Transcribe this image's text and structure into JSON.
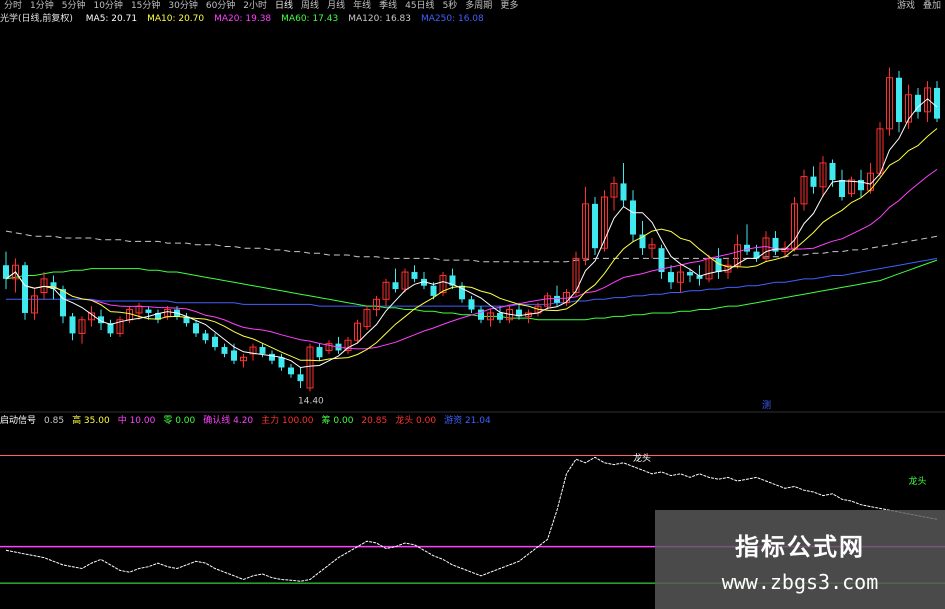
{
  "toolbar": {
    "periods": [
      {
        "label": "分时",
        "active": false
      },
      {
        "label": "1分钟",
        "active": false
      },
      {
        "label": "5分钟",
        "active": false
      },
      {
        "label": "10分钟",
        "active": false
      },
      {
        "label": "15分钟",
        "active": false
      },
      {
        "label": "30分钟",
        "active": false
      },
      {
        "label": "60分钟",
        "active": false
      },
      {
        "label": "2小时",
        "active": false
      },
      {
        "label": "日线",
        "active": true
      },
      {
        "label": "周线",
        "active": false
      },
      {
        "label": "月线",
        "active": false
      },
      {
        "label": "年线",
        "active": false
      },
      {
        "label": "季线",
        "active": false
      },
      {
        "label": "45日线",
        "active": false
      },
      {
        "label": "5秒",
        "active": false
      },
      {
        "label": "多周期",
        "active": false
      },
      {
        "label": "更多",
        "active": false
      }
    ],
    "right": [
      "游戏",
      "叠加"
    ]
  },
  "ma_legend": {
    "title": "光学(日线,前复权)",
    "items": [
      {
        "label": "MA5: 20.71",
        "color": "#ffffff"
      },
      {
        "label": "MA10: 20.70",
        "color": "#ffff40"
      },
      {
        "label": "MA20: 19.38",
        "color": "#ff40ff"
      },
      {
        "label": "MA60: 17.43",
        "color": "#40ff40"
      },
      {
        "label": "MA120: 16.83",
        "color": "#c8c8c8"
      },
      {
        "label": "MA250: 16.08",
        "color": "#4060ff"
      }
    ]
  },
  "annotations": {
    "low_price": "14.40",
    "bottom_marker": "测",
    "top_label": "龙头",
    "right_label": "龙头"
  },
  "indicator_legend": {
    "items": [
      {
        "label": "启动信号",
        "color": "#ffffff"
      },
      {
        "label": "0.85",
        "color": "#c8c8c8"
      },
      {
        "label": "高 35.00",
        "color": "#ffff40"
      },
      {
        "label": "中 10.00",
        "color": "#ff40ff"
      },
      {
        "label": "零 0.00",
        "color": "#40ff40"
      },
      {
        "label": "确认线 4.20",
        "color": "#ff40ff"
      },
      {
        "label": "主力 100.00",
        "color": "#ff3030"
      },
      {
        "label": "筹 0.00",
        "color": "#40ff40"
      },
      {
        "label": "20.85",
        "color": "#ff3030"
      },
      {
        "label": "龙头 0.00",
        "color": "#ff3030"
      },
      {
        "label": "游资 21.04",
        "color": "#4060ff"
      }
    ]
  },
  "colors": {
    "up": "#ff3030",
    "down": "#40e8f0",
    "ma5": "#ffffff",
    "ma10": "#ffff40",
    "ma20": "#ff40ff",
    "ma60": "#40ff40",
    "ma120": "#c8c8c8",
    "ma250": "#4060ff"
  },
  "chart_data": {
    "type": "candlestick",
    "title": "",
    "xlabel": "",
    "ylabel": "",
    "ylim": [
      13.5,
      24.5
    ],
    "candles": [
      [
        17.6,
        18.0,
        16.9,
        17.2
      ],
      [
        17.2,
        17.8,
        16.8,
        17.6
      ],
      [
        17.6,
        17.7,
        16.0,
        16.2
      ],
      [
        16.2,
        16.9,
        16.0,
        16.7
      ],
      [
        16.8,
        17.4,
        16.6,
        17.2
      ],
      [
        17.1,
        17.3,
        16.6,
        16.9
      ],
      [
        16.9,
        17.0,
        15.9,
        16.1
      ],
      [
        16.1,
        16.2,
        15.4,
        15.6
      ],
      [
        15.6,
        16.1,
        15.3,
        16.0
      ],
      [
        16.0,
        16.4,
        15.8,
        16.2
      ],
      [
        16.1,
        16.3,
        15.7,
        15.9
      ],
      [
        15.9,
        16.0,
        15.5,
        15.6
      ],
      [
        15.6,
        16.1,
        15.5,
        16.0
      ],
      [
        16.0,
        16.4,
        15.9,
        16.3
      ],
      [
        16.2,
        16.5,
        16.0,
        16.4
      ],
      [
        16.3,
        16.4,
        16.0,
        16.2
      ],
      [
        16.2,
        16.3,
        15.9,
        16.0
      ],
      [
        16.1,
        16.4,
        16.0,
        16.3
      ],
      [
        16.3,
        16.4,
        16.0,
        16.1
      ],
      [
        16.1,
        16.2,
        15.8,
        15.9
      ],
      [
        15.9,
        16.0,
        15.5,
        15.6
      ],
      [
        15.6,
        15.7,
        15.3,
        15.4
      ],
      [
        15.5,
        15.6,
        15.1,
        15.2
      ],
      [
        15.2,
        15.3,
        14.9,
        15.0
      ],
      [
        15.1,
        15.3,
        14.7,
        14.8
      ],
      [
        14.8,
        15.0,
        14.6,
        14.9
      ],
      [
        15.0,
        15.3,
        14.8,
        15.2
      ],
      [
        15.2,
        15.3,
        14.9,
        15.0
      ],
      [
        15.0,
        15.1,
        14.7,
        14.8
      ],
      [
        14.9,
        15.0,
        14.5,
        14.6
      ],
      [
        14.6,
        14.7,
        14.3,
        14.4
      ],
      [
        14.4,
        14.6,
        14.0,
        14.2
      ],
      [
        14.0,
        15.3,
        13.9,
        15.2
      ],
      [
        15.2,
        15.3,
        14.8,
        14.9
      ],
      [
        15.1,
        15.4,
        15.0,
        15.3
      ],
      [
        15.3,
        15.5,
        15.0,
        15.1
      ],
      [
        15.1,
        15.5,
        15.0,
        15.4
      ],
      [
        15.4,
        16.0,
        15.3,
        15.9
      ],
      [
        15.8,
        16.4,
        15.7,
        16.3
      ],
      [
        16.3,
        16.7,
        16.1,
        16.6
      ],
      [
        16.6,
        17.2,
        16.4,
        17.1
      ],
      [
        17.1,
        17.5,
        16.8,
        16.9
      ],
      [
        16.9,
        17.5,
        16.8,
        17.4
      ],
      [
        17.4,
        17.6,
        17.1,
        17.2
      ],
      [
        17.2,
        17.4,
        16.9,
        17.0
      ],
      [
        17.0,
        17.1,
        16.6,
        16.7
      ],
      [
        16.8,
        17.4,
        16.7,
        17.3
      ],
      [
        17.3,
        17.5,
        16.9,
        17.0
      ],
      [
        17.0,
        17.1,
        16.5,
        16.6
      ],
      [
        16.6,
        16.7,
        16.2,
        16.3
      ],
      [
        16.3,
        16.4,
        15.9,
        16.0
      ],
      [
        16.0,
        16.3,
        15.8,
        16.2
      ],
      [
        16.2,
        16.4,
        15.9,
        16.0
      ],
      [
        16.0,
        16.4,
        15.9,
        16.3
      ],
      [
        16.3,
        16.5,
        16.0,
        16.1
      ],
      [
        16.1,
        16.3,
        15.9,
        16.2
      ],
      [
        16.2,
        16.5,
        16.1,
        16.4
      ],
      [
        16.4,
        16.8,
        16.3,
        16.7
      ],
      [
        16.7,
        17.0,
        16.4,
        16.5
      ],
      [
        16.5,
        16.9,
        16.4,
        16.8
      ],
      [
        16.8,
        18.0,
        16.7,
        17.8
      ],
      [
        17.8,
        19.9,
        17.6,
        19.4
      ],
      [
        19.4,
        19.6,
        17.9,
        18.1
      ],
      [
        18.1,
        19.8,
        18.0,
        19.6
      ],
      [
        19.6,
        20.2,
        19.2,
        20.0
      ],
      [
        20.0,
        20.6,
        19.3,
        19.5
      ],
      [
        19.5,
        19.8,
        18.3,
        18.5
      ],
      [
        18.5,
        18.9,
        17.9,
        18.1
      ],
      [
        18.1,
        18.4,
        17.8,
        18.2
      ],
      [
        18.1,
        18.2,
        17.2,
        17.4
      ],
      [
        17.4,
        17.6,
        16.9,
        17.1
      ],
      [
        17.1,
        17.6,
        16.8,
        17.4
      ],
      [
        17.4,
        17.5,
        17.1,
        17.3
      ],
      [
        17.3,
        17.6,
        17.0,
        17.2
      ],
      [
        17.2,
        17.9,
        17.1,
        17.8
      ],
      [
        17.8,
        18.1,
        17.2,
        17.4
      ],
      [
        17.4,
        17.8,
        17.2,
        17.6
      ],
      [
        17.6,
        18.5,
        17.5,
        18.2
      ],
      [
        18.2,
        18.8,
        17.9,
        18.0
      ],
      [
        18.0,
        18.2,
        17.7,
        17.8
      ],
      [
        17.8,
        18.6,
        17.7,
        18.4
      ],
      [
        18.4,
        18.6,
        17.9,
        18.0
      ],
      [
        18.0,
        18.3,
        17.8,
        18.1
      ],
      [
        18.1,
        19.6,
        18.0,
        19.4
      ],
      [
        19.4,
        20.4,
        19.2,
        20.2
      ],
      [
        20.2,
        20.5,
        19.7,
        19.9
      ],
      [
        19.9,
        20.8,
        19.6,
        20.6
      ],
      [
        20.6,
        20.7,
        19.9,
        20.1
      ],
      [
        20.1,
        20.4,
        19.5,
        19.6
      ],
      [
        19.7,
        20.2,
        19.6,
        20.1
      ],
      [
        20.1,
        20.4,
        19.6,
        19.8
      ],
      [
        19.8,
        20.6,
        19.7,
        20.3
      ],
      [
        20.3,
        21.8,
        20.2,
        21.6
      ],
      [
        21.6,
        23.4,
        21.4,
        23.1
      ],
      [
        23.1,
        23.3,
        21.5,
        21.8
      ],
      [
        21.8,
        22.9,
        21.6,
        22.6
      ],
      [
        22.6,
        22.8,
        21.9,
        22.1
      ],
      [
        22.1,
        23.0,
        21.8,
        22.8
      ],
      [
        22.8,
        23.0,
        21.8,
        21.9
      ]
    ],
    "ma120": [
      18.6,
      18.55,
      18.5,
      18.45,
      18.45,
      18.45,
      18.4,
      18.4,
      18.4,
      18.4,
      18.35,
      18.35,
      18.35,
      18.3,
      18.3,
      18.3,
      18.3,
      18.25,
      18.25,
      18.25,
      18.2,
      18.2,
      18.2,
      18.15,
      18.15,
      18.1,
      18.1,
      18.1,
      18.05,
      18.05,
      18.0,
      18.0,
      17.95,
      17.95,
      17.9,
      17.9,
      17.9,
      17.85,
      17.85,
      17.85,
      17.8,
      17.8,
      17.8,
      17.8,
      17.8,
      17.8,
      17.75,
      17.75,
      17.75,
      17.75,
      17.7,
      17.7,
      17.7,
      17.7,
      17.7,
      17.7,
      17.7,
      17.7,
      17.7,
      17.7,
      17.75,
      17.75,
      17.8,
      17.8,
      17.8,
      17.8,
      17.8,
      17.8,
      17.8,
      17.8,
      17.8,
      17.8,
      17.8,
      17.8,
      17.8,
      17.8,
      17.8,
      17.8,
      17.8,
      17.8,
      17.85,
      17.85,
      17.85,
      17.9,
      17.9,
      17.95,
      17.95,
      18.0,
      18.0,
      18.05,
      18.05,
      18.1,
      18.15,
      18.2,
      18.25,
      18.3,
      18.35,
      18.4,
      18.45
    ],
    "ma250": [
      16.6,
      16.6,
      16.6,
      16.6,
      16.6,
      16.6,
      16.6,
      16.6,
      16.6,
      16.6,
      16.55,
      16.55,
      16.55,
      16.55,
      16.55,
      16.55,
      16.55,
      16.55,
      16.5,
      16.5,
      16.5,
      16.5,
      16.5,
      16.5,
      16.5,
      16.45,
      16.45,
      16.45,
      16.45,
      16.45,
      16.45,
      16.45,
      16.45,
      16.4,
      16.4,
      16.4,
      16.4,
      16.4,
      16.4,
      16.4,
      16.4,
      16.4,
      16.4,
      16.4,
      16.4,
      16.4,
      16.4,
      16.4,
      16.4,
      16.4,
      16.4,
      16.4,
      16.4,
      16.4,
      16.45,
      16.45,
      16.45,
      16.45,
      16.5,
      16.5,
      16.55,
      16.55,
      16.6,
      16.6,
      16.65,
      16.65,
      16.7,
      16.7,
      16.75,
      16.75,
      16.8,
      16.8,
      16.85,
      16.85,
      16.9,
      16.9,
      16.95,
      16.95,
      17.0,
      17.0,
      17.05,
      17.1,
      17.1,
      17.15,
      17.2,
      17.2,
      17.25,
      17.3,
      17.3,
      17.35,
      17.4,
      17.45,
      17.5,
      17.55,
      17.6,
      17.65,
      17.7,
      17.75,
      17.8
    ],
    "ma60": [
      17.2,
      17.25,
      17.3,
      17.3,
      17.35,
      17.4,
      17.4,
      17.45,
      17.45,
      17.5,
      17.5,
      17.5,
      17.5,
      17.5,
      17.5,
      17.45,
      17.45,
      17.4,
      17.4,
      17.35,
      17.3,
      17.25,
      17.2,
      17.15,
      17.1,
      17.05,
      17.0,
      16.95,
      16.9,
      16.85,
      16.8,
      16.75,
      16.7,
      16.65,
      16.6,
      16.55,
      16.5,
      16.45,
      16.4,
      16.4,
      16.35,
      16.35,
      16.3,
      16.3,
      16.25,
      16.25,
      16.2,
      16.2,
      16.15,
      16.15,
      16.1,
      16.1,
      16.1,
      16.05,
      16.05,
      16.05,
      16.0,
      16.0,
      16.0,
      16.0,
      16.0,
      16.0,
      16.05,
      16.05,
      16.1,
      16.1,
      16.15,
      16.15,
      16.2,
      16.2,
      16.2,
      16.25,
      16.25,
      16.3,
      16.3,
      16.35,
      16.4,
      16.4,
      16.45,
      16.5,
      16.55,
      16.6,
      16.65,
      16.7,
      16.75,
      16.8,
      16.85,
      16.9,
      16.95,
      17.0,
      17.05,
      17.1,
      17.15,
      17.25,
      17.35,
      17.45,
      17.55,
      17.65,
      17.75
    ],
    "osc": [
      9.0,
      8.5,
      8.0,
      7.5,
      7.0,
      6.0,
      5.0,
      4.5,
      4.0,
      5.5,
      6.5,
      5.0,
      3.5,
      3.0,
      4.0,
      4.5,
      5.5,
      4.5,
      4.0,
      5.0,
      6.0,
      5.5,
      4.0,
      3.0,
      2.0,
      1.0,
      2.0,
      2.5,
      1.5,
      1.0,
      0.8,
      0.5,
      1.0,
      3.0,
      5.0,
      7.0,
      8.5,
      10.0,
      11.5,
      11.0,
      9.5,
      10.0,
      11.0,
      10.5,
      9.0,
      7.5,
      6.5,
      5.0,
      4.0,
      3.0,
      2.0,
      3.0,
      4.0,
      5.0,
      6.0,
      8.0,
      10.0,
      12.0,
      20.0,
      30.0,
      34.0,
      33.0,
      34.5,
      33.0,
      32.5,
      33.0,
      32.0,
      31.0,
      30.0,
      30.5,
      29.5,
      30.0,
      29.0,
      30.0,
      29.0,
      28.5,
      29.0,
      28.0,
      28.5,
      29.0,
      28.0,
      27.0,
      26.0,
      26.5,
      25.5,
      25.0,
      24.0,
      24.5,
      23.0,
      22.5,
      21.5,
      21.0,
      20.5,
      20.0,
      19.5,
      19.0,
      18.5,
      18.0,
      17.5
    ],
    "osc_ylim": [
      -6.0,
      42.0
    ],
    "osc_levels": {
      "high": 35.0,
      "mid": 10.0,
      "zero": 0.0
    }
  }
}
